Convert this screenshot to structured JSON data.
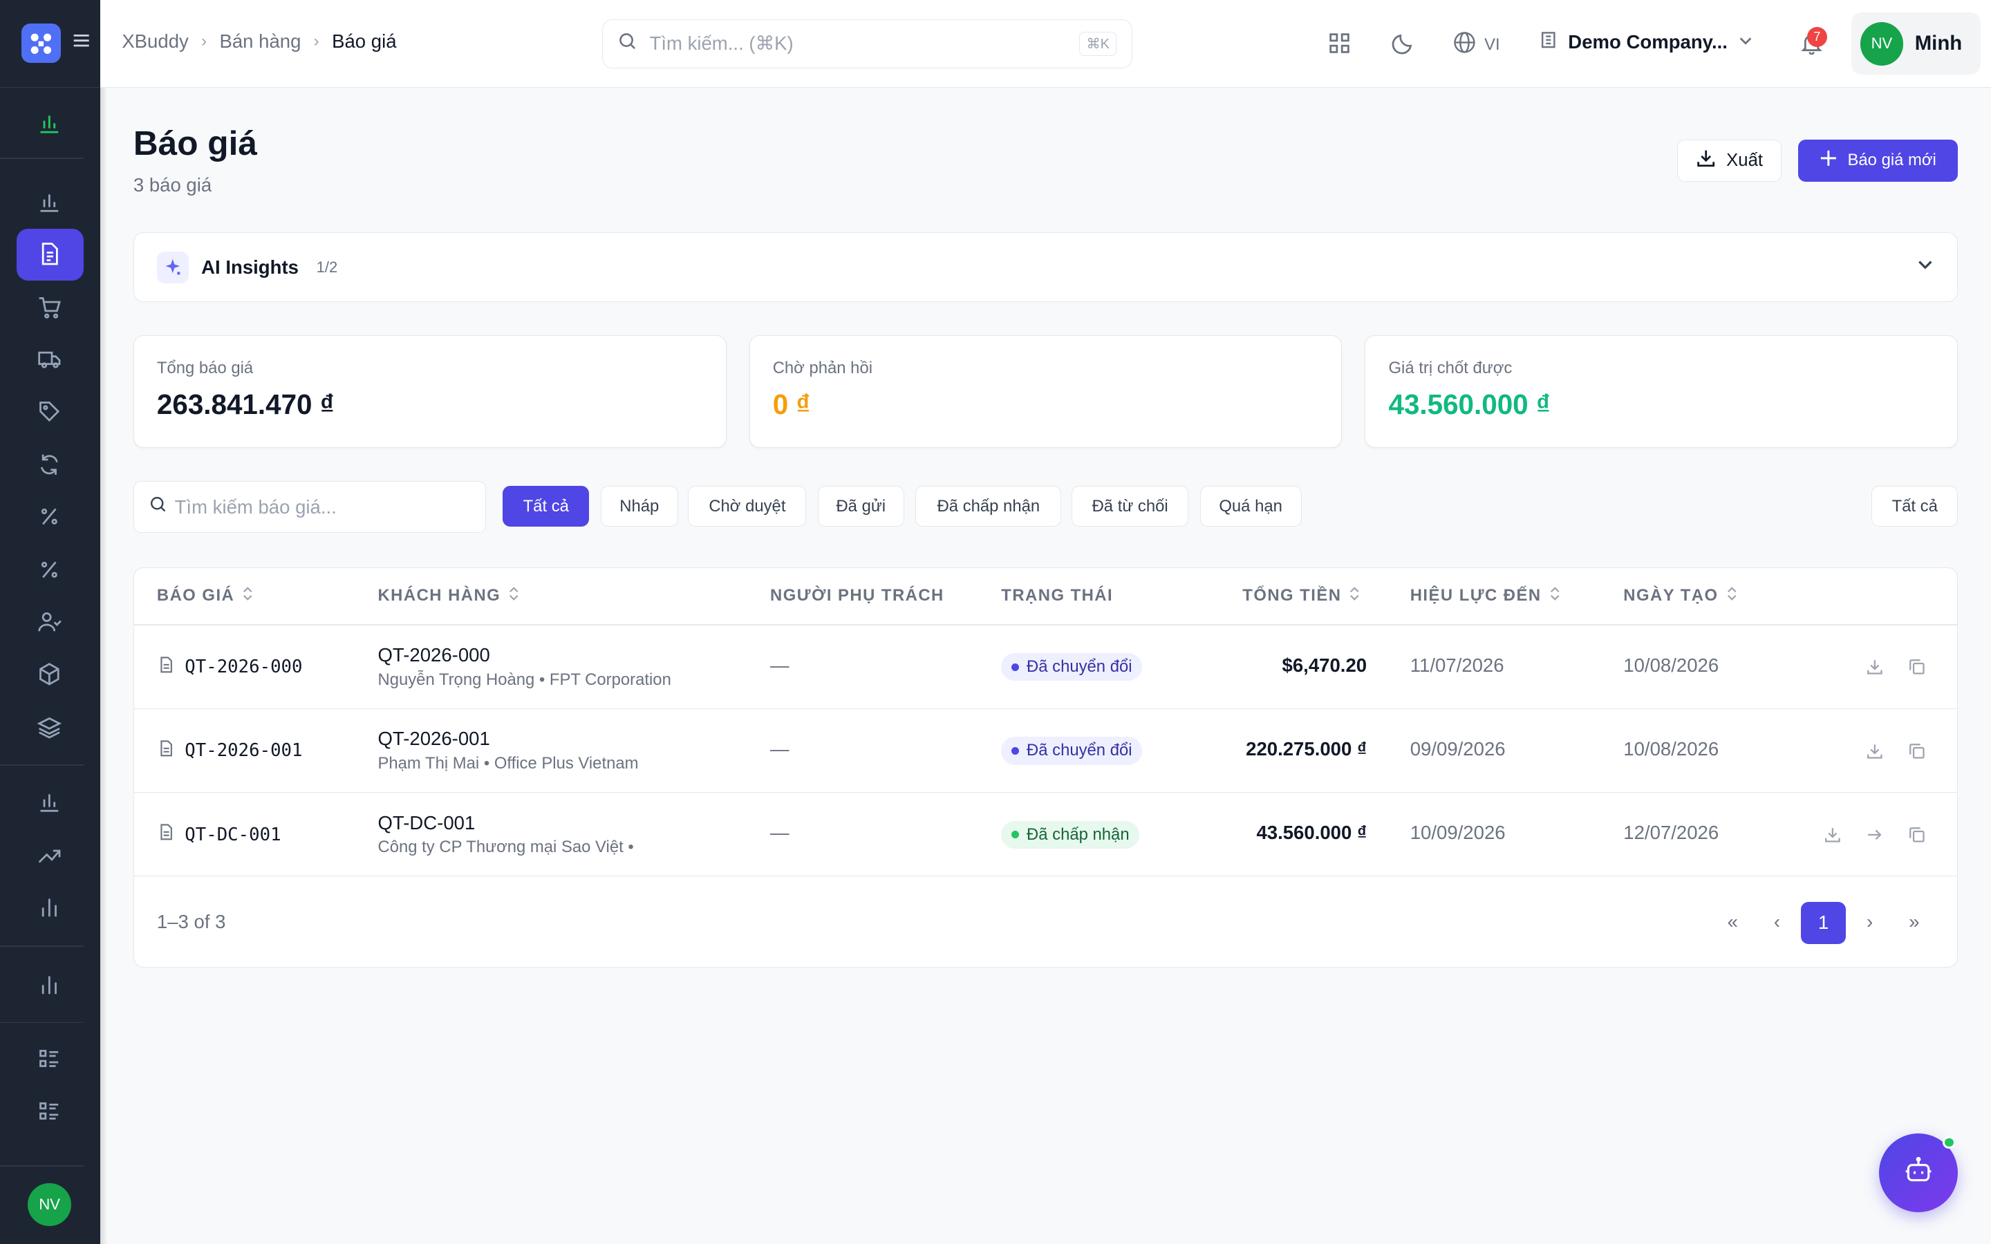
{
  "sidebar": {
    "user_initials": "NV",
    "icons": [
      "dashboard-icon",
      "analytics-icon",
      "quotes-icon",
      "cart-icon",
      "truck-icon",
      "tag-icon",
      "refresh-icon",
      "percent-icon",
      "percent-icon",
      "users-icon",
      "box-icon",
      "layers-icon",
      "chart-icon",
      "trending-icon",
      "bar-chart-icon",
      "report-icon",
      "list-icon",
      "list-icon"
    ]
  },
  "topbar": {
    "breadcrumbs": [
      "XBuddy",
      "Bán hàng",
      "Báo giá"
    ],
    "search_placeholder": "Tìm kiếm... (⌘K)",
    "search_shortcut": "⌘K",
    "language": "VI",
    "company": "Demo Company...",
    "notifications_count": "7",
    "user_initials": "NV",
    "user_name": "Minh"
  },
  "page": {
    "title": "Báo giá",
    "subtitle": "3 báo giá",
    "export_label": "Xuất",
    "new_label": "Báo giá mới"
  },
  "insights": {
    "title": "AI Insights",
    "count": "1/2"
  },
  "stats": [
    {
      "label": "Tổng báo giá",
      "value": "263.841.470 ₫",
      "color": "#111827"
    },
    {
      "label": "Chờ phản hồi",
      "value": "0 ₫",
      "color": "#f59e0b"
    },
    {
      "label": "Giá trị chốt được",
      "value": "43.560.000 ₫",
      "color": "#10b981"
    }
  ],
  "filters": {
    "search_placeholder": "Tìm kiếm báo giá...",
    "chips": [
      "Tất cả",
      "Nháp",
      "Chờ duyệt",
      "Đã gửi",
      "Đã chấp nhận",
      "Đã từ chối",
      "Quá hạn"
    ],
    "right_chip": "Tất cả"
  },
  "table": {
    "headers": [
      "BÁO GIÁ",
      "KHÁCH HÀNG",
      "NGƯỜI PHỤ TRÁCH",
      "TRẠNG THÁI",
      "TỔNG TIỀN",
      "HIỆU LỰC ĐẾN",
      "NGÀY TẠO"
    ],
    "rows": [
      {
        "code": "QT-2026-000",
        "title": "QT-2026-000",
        "customer": "Nguyễn Trọng Hoàng • FPT Corporation",
        "owner": "—",
        "status": "Đã chuyển đổi",
        "amount": "$6,470.20",
        "valid_until": "11/07/2026",
        "created": "10/08/2026"
      },
      {
        "code": "QT-2026-001",
        "title": "QT-2026-001",
        "customer": "Phạm Thị Mai • Office Plus Vietnam",
        "owner": "—",
        "status": "Đã chuyển đổi",
        "amount": "220.275.000 ₫",
        "valid_until": "09/09/2026",
        "created": "10/08/2026"
      },
      {
        "code": "QT-DC-001",
        "title": "QT-DC-001",
        "customer": "Công ty CP Thương mại Sao Việt •",
        "owner": "—",
        "status": "Đã chấp nhận",
        "amount": "43.560.000 ₫",
        "valid_until": "10/09/2026",
        "created": "12/07/2026"
      }
    ],
    "pagination_text": "1–3 of 3",
    "current_page": "1"
  },
  "colors": {
    "accent": "#4f46e5",
    "sidebar_bg": "#1e2532",
    "pending": "#f59e0b",
    "success": "#10b981"
  }
}
